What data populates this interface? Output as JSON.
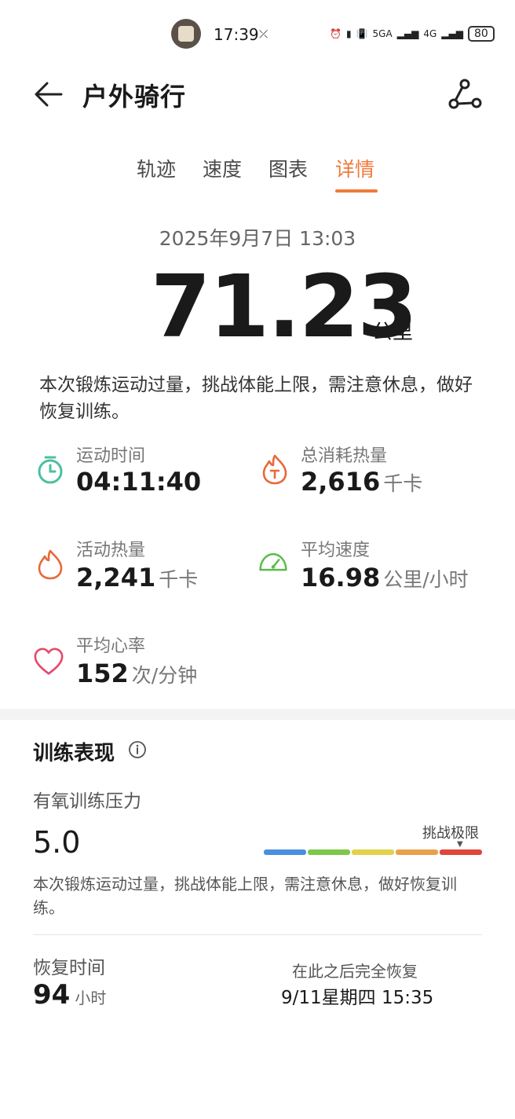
{
  "status_bar": {
    "time": "17:39",
    "network1": "5GA",
    "network2": "4G",
    "battery": "80"
  },
  "header": {
    "title": "户外骑行"
  },
  "tabs": [
    {
      "label": "轨迹",
      "active": false
    },
    {
      "label": "速度",
      "active": false
    },
    {
      "label": "图表",
      "active": false
    },
    {
      "label": "详情",
      "active": true
    }
  ],
  "workout": {
    "date": "2025年9月7日 13:03",
    "distance": "71.23",
    "distance_unit": "公里",
    "summary": "本次锻炼运动过量，挑战体能上限，需注意休息，做好恢复训练。"
  },
  "stats": [
    {
      "label": "运动时间",
      "value": "04:11:40",
      "unit": "",
      "icon": "stopwatch-icon",
      "color": "#4dbfa0"
    },
    {
      "label": "总消耗热量",
      "value": "2,616",
      "unit": "千卡",
      "icon": "flame-total-icon",
      "color": "#e8683a"
    },
    {
      "label": "活动热量",
      "value": "2,241",
      "unit": "千卡",
      "icon": "flame-icon",
      "color": "#e8683a"
    },
    {
      "label": "平均速度",
      "value": "16.98",
      "unit": "公里/小时",
      "icon": "speedometer-icon",
      "color": "#5dbb4c"
    },
    {
      "label": "平均心率",
      "value": "152",
      "unit": "次/分钟",
      "icon": "heart-icon",
      "color": "#e54b6a"
    }
  ],
  "training": {
    "title": "训练表现",
    "aerobic_label": "有氧训练压力",
    "aerobic_value": "5.0",
    "scale_label": "挑战极限",
    "scale_colors": [
      "#4a8fe0",
      "#7cc84a",
      "#e0d24a",
      "#e8a24a",
      "#e0463a"
    ],
    "description": "本次锻炼运动过量，挑战体能上限，需注意休息，做好恢复训练。",
    "recovery_label": "恢复时间",
    "recovery_value": "94",
    "recovery_unit": "小时",
    "recovery_right_label": "在此之后完全恢复",
    "recovery_right_value": "9/11星期四 15:35"
  }
}
